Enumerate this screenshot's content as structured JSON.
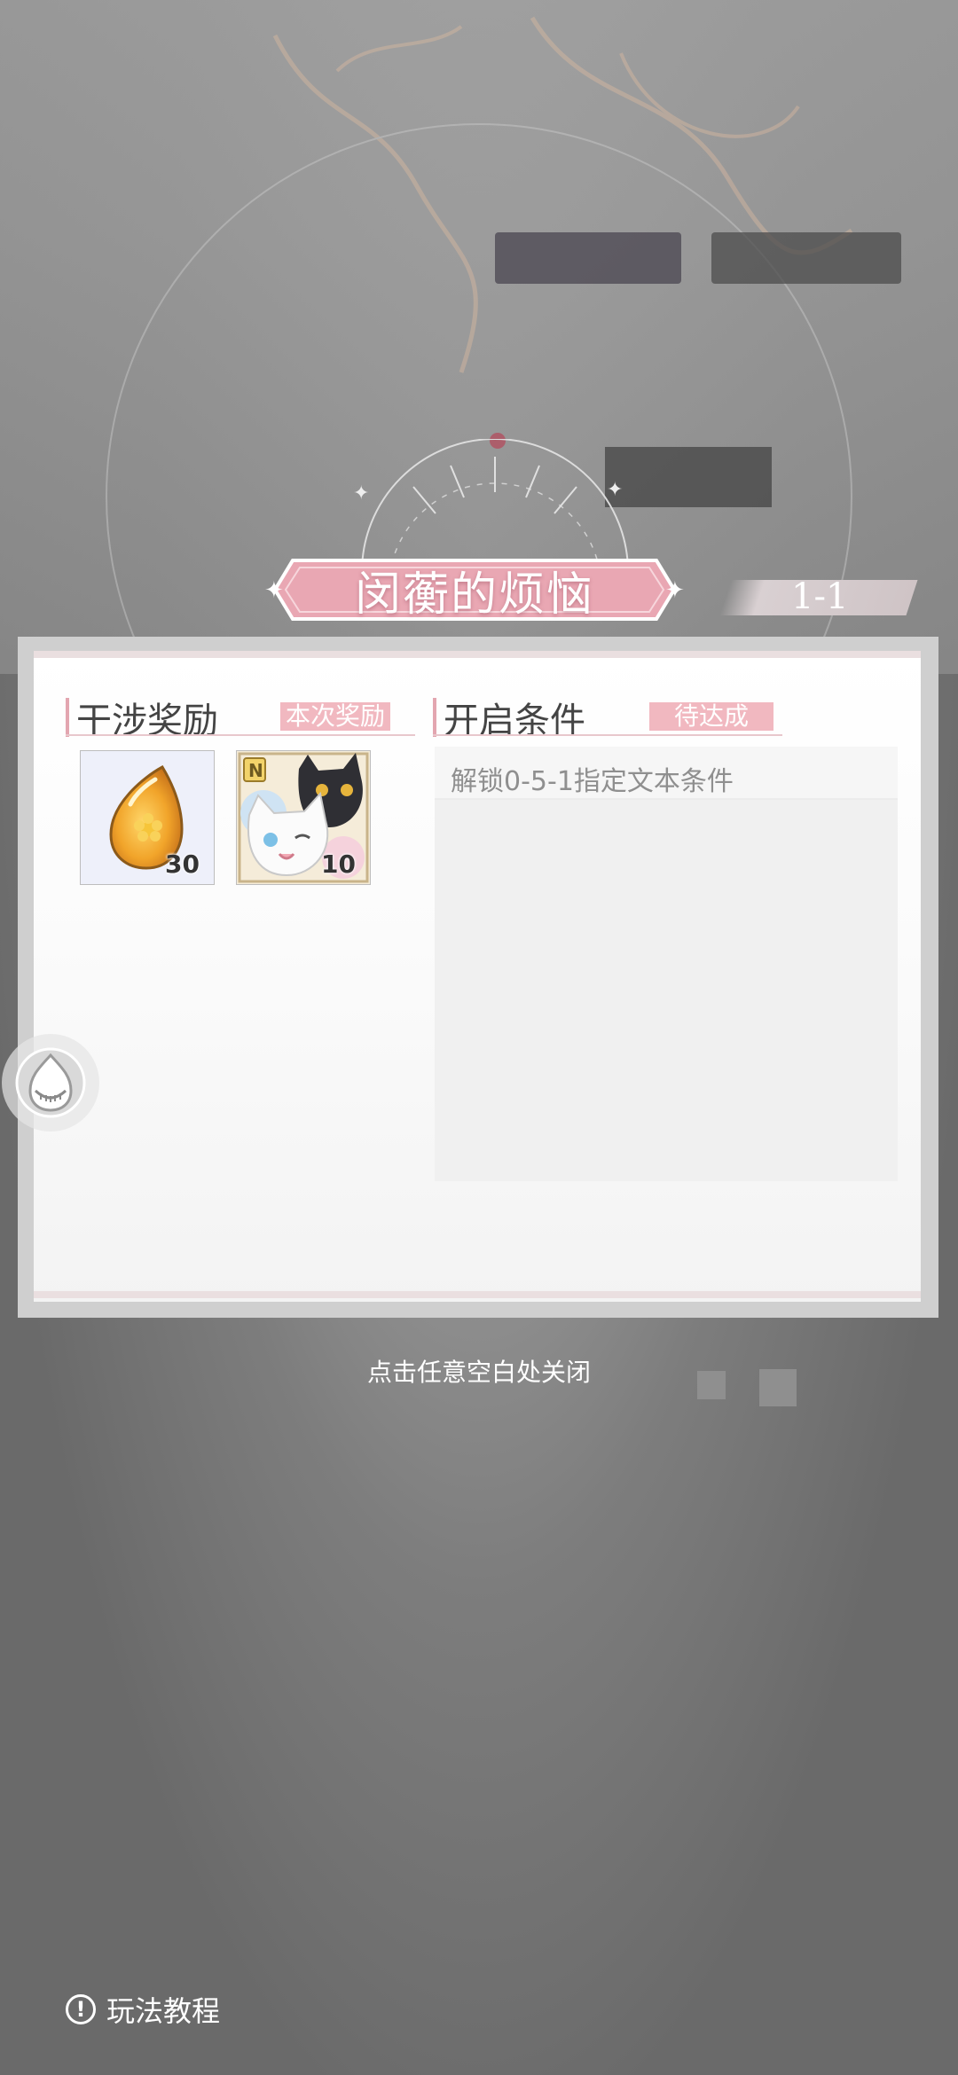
{
  "dialog": {
    "title": "闵蘅的烦恼",
    "stage": "1-1"
  },
  "rewards": {
    "heading": "干涉奖励",
    "badge": "本次奖励",
    "items": [
      {
        "icon": "amber-gem-icon",
        "qty": "30"
      },
      {
        "icon": "cat-card-icon",
        "qty": "10"
      }
    ]
  },
  "conditions": {
    "heading": "开启条件",
    "badge": "待达成",
    "items": [
      "解锁0-5-1指定文本条件"
    ]
  },
  "footer": {
    "close_hint": "点击任意空白处关闭",
    "tutorial": "玩法教程"
  },
  "colors": {
    "accent_pink": "#f1b8c0",
    "ribbon_pink": "#e9a7b3",
    "overlay_gray": "#6f6f6f"
  }
}
